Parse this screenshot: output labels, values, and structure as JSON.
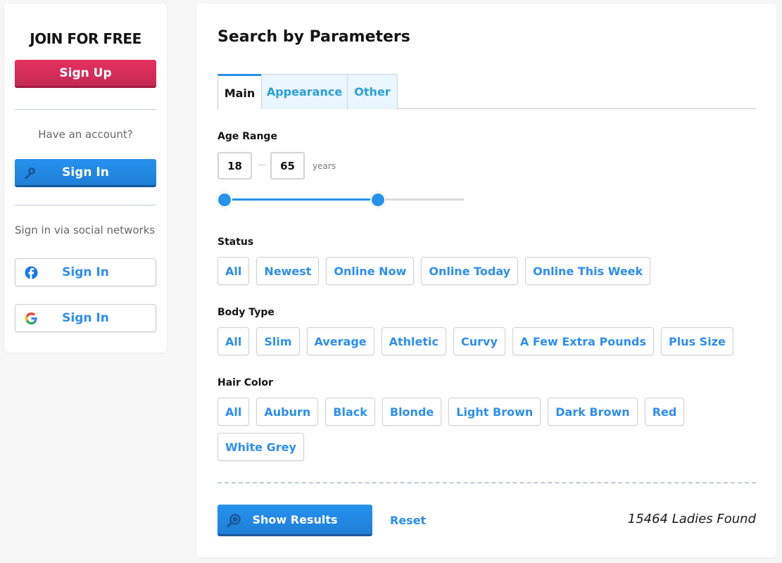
{
  "sidebar": {
    "join_title": "JOIN FOR FREE",
    "signup_label": "Sign Up",
    "have_account": "Have an account?",
    "signin_label": "Sign In",
    "social_label": "Sign in via social networks",
    "social": [
      {
        "network": "facebook",
        "icon": "facebook-icon",
        "label": "Sign In"
      },
      {
        "network": "google",
        "icon": "google-icon",
        "label": "Sign In"
      }
    ]
  },
  "main": {
    "title": "Search by Parameters",
    "tabs": [
      {
        "label": "Main",
        "active": true
      },
      {
        "label": "Appearance",
        "active": false
      },
      {
        "label": "Other",
        "active": false
      }
    ],
    "age_range": {
      "label": "Age Range",
      "min": "18",
      "max": "65",
      "unit": "years",
      "slider_low_fraction": 0.0,
      "slider_high_fraction": 0.64
    },
    "status": {
      "label": "Status",
      "options": [
        "All",
        "Newest",
        "Online Now",
        "Online Today",
        "Online This Week"
      ]
    },
    "body_type": {
      "label": "Body Type",
      "options": [
        "All",
        "Slim",
        "Average",
        "Athletic",
        "Curvy",
        "A Few Extra Pounds",
        "Plus Size"
      ]
    },
    "hair_color": {
      "label": "Hair Color",
      "options": [
        "All",
        "Auburn",
        "Black",
        "Blonde",
        "Light Brown",
        "Dark Brown",
        "Red",
        "White Grey"
      ]
    },
    "show_results_label": "Show Results",
    "reset_label": "Reset",
    "results_count_text": "15464 Ladies Found"
  },
  "colors": {
    "primary_blue": "#2592ee",
    "signup_pink": "#e5305f",
    "tab_inactive_bg": "#eaf6fd",
    "link_blue": "#2d8ef0"
  }
}
